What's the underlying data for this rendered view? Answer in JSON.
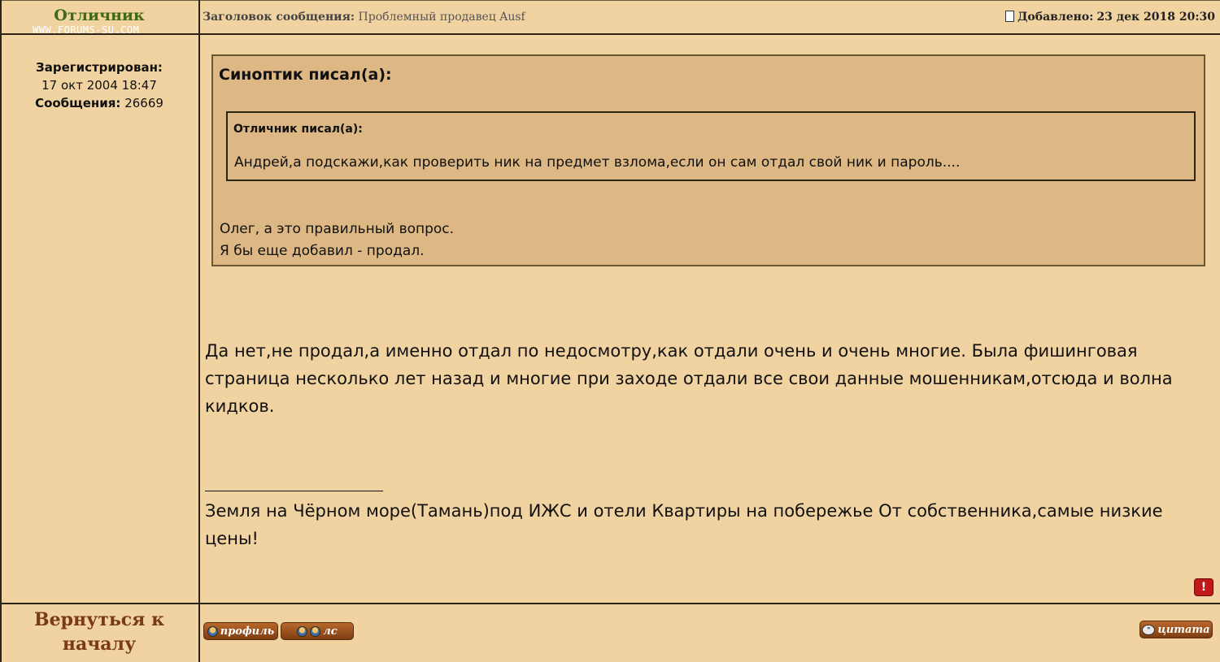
{
  "author": {
    "name": "Отличник",
    "watermark": "WWW.FORUMS-SU.COM",
    "registered_label": "Зарегистрирован:",
    "registered_value": "17 окт 2004 18:47",
    "posts_label": "Сообщения:",
    "posts_value": "26669"
  },
  "header": {
    "subject_label": "Заголовок сообщения:",
    "subject_value": "Проблемный продавец Ausf",
    "added_label": "Добавлено:",
    "added_value": "23 дек 2018 20:30"
  },
  "quote": {
    "outer_author": "Синоптик писал(а):",
    "inner_author": "Отличник писал(а):",
    "inner_text": "Андрей,а подскажи,как проверить ник на предмет взлома,если он сам отдал свой ник и пароль....",
    "reply_line1": "Олег, а это правильный вопрос.",
    "reply_line2": "Я бы еще добавил - продал."
  },
  "message": {
    "text": "Да нет,не продал,а именно отдал по недосмотру,как отдали очень и очень многие. Была фишинговая страница несколько лет назад и многие при заходе отдали все свои данные мошенникам,отсюда и волна кидков.",
    "signature": "Земля на Чёрном море(Тамань)под ИЖС и отели Квартиры на побережье От собственника,самые низкие цены!"
  },
  "footer": {
    "back_label": "Вернуться к началу",
    "profile_label": "профиль",
    "pm_label": "лс",
    "quote_label": "цитата",
    "report_label": "!"
  },
  "icons": {
    "document": "document-icon",
    "user": "user-icon",
    "users": "users-icon",
    "quote": "quote-bubble-icon",
    "report": "exclamation-icon"
  }
}
